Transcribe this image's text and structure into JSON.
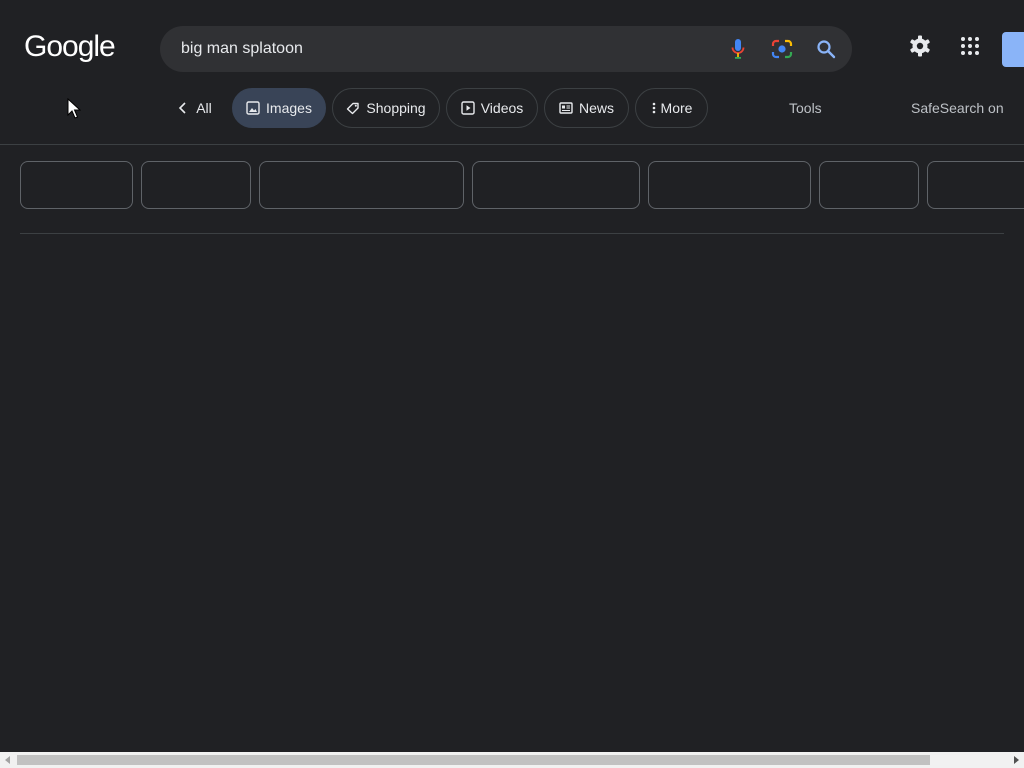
{
  "header": {
    "logo_text": "Google",
    "search_value": "big man splatoon"
  },
  "tabs": {
    "all": "All",
    "images": "Images",
    "shopping": "Shopping",
    "videos": "Videos",
    "news": "News",
    "more": "More",
    "tools": "Tools",
    "safesearch": "SafeSearch on"
  },
  "icons": {
    "mic": "microphone-icon",
    "lens": "google-lens-icon",
    "search": "search-icon",
    "settings": "gear-icon",
    "apps": "apps-grid-icon"
  },
  "colors": {
    "background": "#202124",
    "search_box": "#303134",
    "active_tab": "#394457",
    "accent_blue": "#8ab4f8"
  },
  "filter_chips_count": 7
}
